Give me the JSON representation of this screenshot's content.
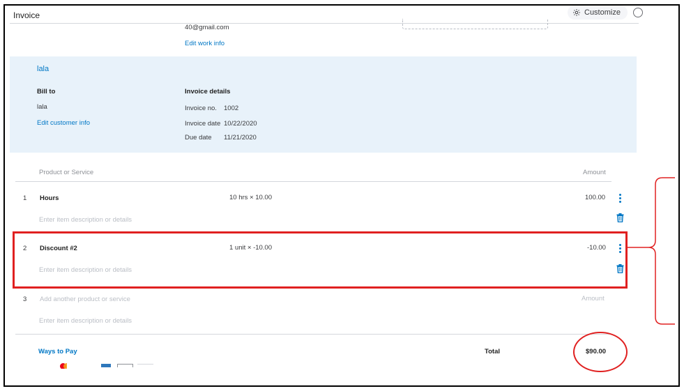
{
  "header": {
    "title": "Invoice",
    "customize_label": "Customize"
  },
  "company": {
    "email": "40@gmail.com",
    "edit_work_info": "Edit work info"
  },
  "customer": {
    "name": "lala",
    "bill_to_heading": "Bill to",
    "bill_to_name": "lala",
    "edit_customer_info": "Edit customer info"
  },
  "invoice_details": {
    "heading": "Invoice details",
    "invoice_no_label": "Invoice no.",
    "invoice_no": "1002",
    "invoice_date_label": "Invoice date",
    "invoice_date": "10/22/2020",
    "due_date_label": "Due date",
    "due_date": "11/21/2020"
  },
  "table": {
    "col_product": "Product or Service",
    "col_amount": "Amount",
    "description_placeholder": "Enter item description or details",
    "items": [
      {
        "num": "1",
        "name": "Hours",
        "qty_rate": "10 hrs × 10.00",
        "amount": "100.00"
      },
      {
        "num": "2",
        "name": "Discount #2",
        "qty_rate": "1 unit × -10.00",
        "amount": "-10.00"
      }
    ],
    "new_row": {
      "num": "3",
      "placeholder": "Add another product or service",
      "amount_placeholder": "Amount"
    }
  },
  "footer": {
    "ways_to_pay": "Ways to Pay",
    "total_label": "Total",
    "total_value": "$90.00"
  },
  "colors": {
    "accent": "#0077c5",
    "panel": "#e8f2fa",
    "annotation": "#e02020"
  }
}
